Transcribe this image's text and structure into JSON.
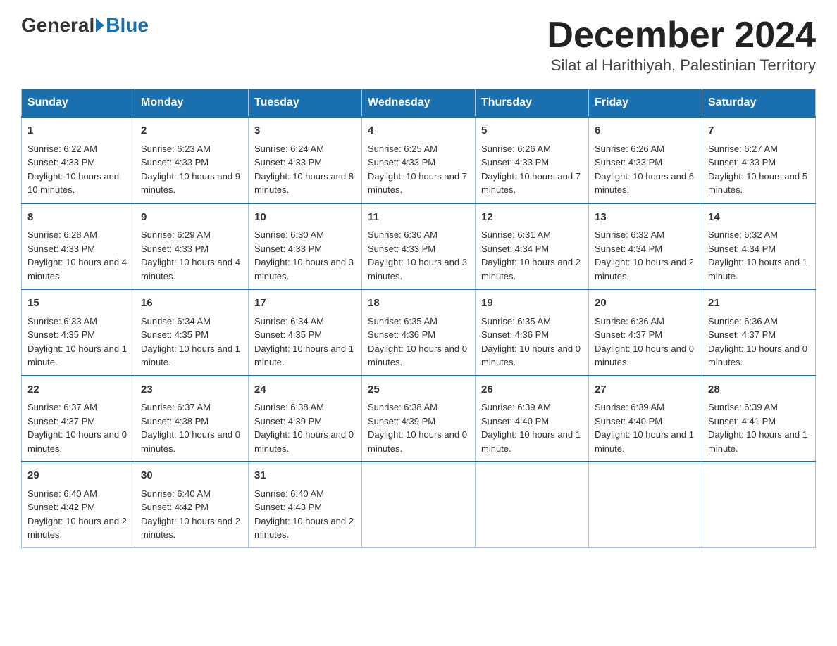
{
  "header": {
    "logo_general": "General",
    "logo_blue": "Blue",
    "month_title": "December 2024",
    "subtitle": "Silat al Harithiyah, Palestinian Territory"
  },
  "days_of_week": [
    "Sunday",
    "Monday",
    "Tuesday",
    "Wednesday",
    "Thursday",
    "Friday",
    "Saturday"
  ],
  "weeks": [
    [
      {
        "day": "1",
        "sunrise": "Sunrise: 6:22 AM",
        "sunset": "Sunset: 4:33 PM",
        "daylight": "Daylight: 10 hours and 10 minutes."
      },
      {
        "day": "2",
        "sunrise": "Sunrise: 6:23 AM",
        "sunset": "Sunset: 4:33 PM",
        "daylight": "Daylight: 10 hours and 9 minutes."
      },
      {
        "day": "3",
        "sunrise": "Sunrise: 6:24 AM",
        "sunset": "Sunset: 4:33 PM",
        "daylight": "Daylight: 10 hours and 8 minutes."
      },
      {
        "day": "4",
        "sunrise": "Sunrise: 6:25 AM",
        "sunset": "Sunset: 4:33 PM",
        "daylight": "Daylight: 10 hours and 7 minutes."
      },
      {
        "day": "5",
        "sunrise": "Sunrise: 6:26 AM",
        "sunset": "Sunset: 4:33 PM",
        "daylight": "Daylight: 10 hours and 7 minutes."
      },
      {
        "day": "6",
        "sunrise": "Sunrise: 6:26 AM",
        "sunset": "Sunset: 4:33 PM",
        "daylight": "Daylight: 10 hours and 6 minutes."
      },
      {
        "day": "7",
        "sunrise": "Sunrise: 6:27 AM",
        "sunset": "Sunset: 4:33 PM",
        "daylight": "Daylight: 10 hours and 5 minutes."
      }
    ],
    [
      {
        "day": "8",
        "sunrise": "Sunrise: 6:28 AM",
        "sunset": "Sunset: 4:33 PM",
        "daylight": "Daylight: 10 hours and 4 minutes."
      },
      {
        "day": "9",
        "sunrise": "Sunrise: 6:29 AM",
        "sunset": "Sunset: 4:33 PM",
        "daylight": "Daylight: 10 hours and 4 minutes."
      },
      {
        "day": "10",
        "sunrise": "Sunrise: 6:30 AM",
        "sunset": "Sunset: 4:33 PM",
        "daylight": "Daylight: 10 hours and 3 minutes."
      },
      {
        "day": "11",
        "sunrise": "Sunrise: 6:30 AM",
        "sunset": "Sunset: 4:33 PM",
        "daylight": "Daylight: 10 hours and 3 minutes."
      },
      {
        "day": "12",
        "sunrise": "Sunrise: 6:31 AM",
        "sunset": "Sunset: 4:34 PM",
        "daylight": "Daylight: 10 hours and 2 minutes."
      },
      {
        "day": "13",
        "sunrise": "Sunrise: 6:32 AM",
        "sunset": "Sunset: 4:34 PM",
        "daylight": "Daylight: 10 hours and 2 minutes."
      },
      {
        "day": "14",
        "sunrise": "Sunrise: 6:32 AM",
        "sunset": "Sunset: 4:34 PM",
        "daylight": "Daylight: 10 hours and 1 minute."
      }
    ],
    [
      {
        "day": "15",
        "sunrise": "Sunrise: 6:33 AM",
        "sunset": "Sunset: 4:35 PM",
        "daylight": "Daylight: 10 hours and 1 minute."
      },
      {
        "day": "16",
        "sunrise": "Sunrise: 6:34 AM",
        "sunset": "Sunset: 4:35 PM",
        "daylight": "Daylight: 10 hours and 1 minute."
      },
      {
        "day": "17",
        "sunrise": "Sunrise: 6:34 AM",
        "sunset": "Sunset: 4:35 PM",
        "daylight": "Daylight: 10 hours and 1 minute."
      },
      {
        "day": "18",
        "sunrise": "Sunrise: 6:35 AM",
        "sunset": "Sunset: 4:36 PM",
        "daylight": "Daylight: 10 hours and 0 minutes."
      },
      {
        "day": "19",
        "sunrise": "Sunrise: 6:35 AM",
        "sunset": "Sunset: 4:36 PM",
        "daylight": "Daylight: 10 hours and 0 minutes."
      },
      {
        "day": "20",
        "sunrise": "Sunrise: 6:36 AM",
        "sunset": "Sunset: 4:37 PM",
        "daylight": "Daylight: 10 hours and 0 minutes."
      },
      {
        "day": "21",
        "sunrise": "Sunrise: 6:36 AM",
        "sunset": "Sunset: 4:37 PM",
        "daylight": "Daylight: 10 hours and 0 minutes."
      }
    ],
    [
      {
        "day": "22",
        "sunrise": "Sunrise: 6:37 AM",
        "sunset": "Sunset: 4:37 PM",
        "daylight": "Daylight: 10 hours and 0 minutes."
      },
      {
        "day": "23",
        "sunrise": "Sunrise: 6:37 AM",
        "sunset": "Sunset: 4:38 PM",
        "daylight": "Daylight: 10 hours and 0 minutes."
      },
      {
        "day": "24",
        "sunrise": "Sunrise: 6:38 AM",
        "sunset": "Sunset: 4:39 PM",
        "daylight": "Daylight: 10 hours and 0 minutes."
      },
      {
        "day": "25",
        "sunrise": "Sunrise: 6:38 AM",
        "sunset": "Sunset: 4:39 PM",
        "daylight": "Daylight: 10 hours and 0 minutes."
      },
      {
        "day": "26",
        "sunrise": "Sunrise: 6:39 AM",
        "sunset": "Sunset: 4:40 PM",
        "daylight": "Daylight: 10 hours and 1 minute."
      },
      {
        "day": "27",
        "sunrise": "Sunrise: 6:39 AM",
        "sunset": "Sunset: 4:40 PM",
        "daylight": "Daylight: 10 hours and 1 minute."
      },
      {
        "day": "28",
        "sunrise": "Sunrise: 6:39 AM",
        "sunset": "Sunset: 4:41 PM",
        "daylight": "Daylight: 10 hours and 1 minute."
      }
    ],
    [
      {
        "day": "29",
        "sunrise": "Sunrise: 6:40 AM",
        "sunset": "Sunset: 4:42 PM",
        "daylight": "Daylight: 10 hours and 2 minutes."
      },
      {
        "day": "30",
        "sunrise": "Sunrise: 6:40 AM",
        "sunset": "Sunset: 4:42 PM",
        "daylight": "Daylight: 10 hours and 2 minutes."
      },
      {
        "day": "31",
        "sunrise": "Sunrise: 6:40 AM",
        "sunset": "Sunset: 4:43 PM",
        "daylight": "Daylight: 10 hours and 2 minutes."
      },
      null,
      null,
      null,
      null
    ]
  ]
}
